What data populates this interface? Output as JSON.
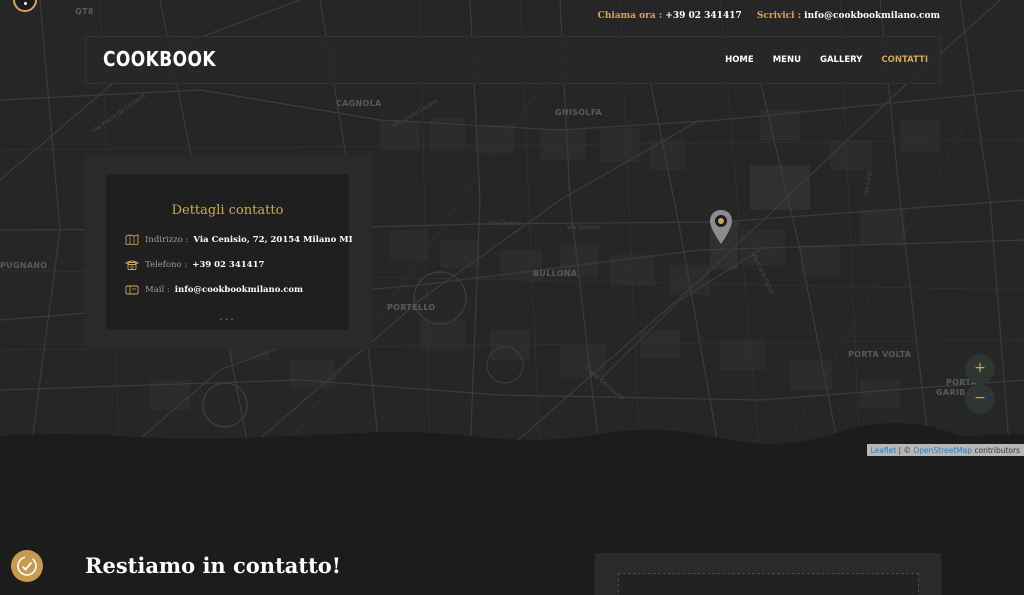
{
  "topbar": {
    "call_label": "Chiama ora :",
    "call_value": "+39 02 341417",
    "write_label": "Scrivici :",
    "write_value": "info@cookbookmilano.com"
  },
  "header": {
    "logo": "COOKBOOK",
    "nav": [
      {
        "label": "HOME",
        "active": false
      },
      {
        "label": "MENU",
        "active": false
      },
      {
        "label": "GALLERY",
        "active": false
      },
      {
        "label": "CONTATTI",
        "active": true
      }
    ]
  },
  "map": {
    "labels": {
      "cagnola": "CAGNOLA",
      "ghisolfa": "GHISOLFA",
      "bullona": "BULLONA",
      "portello": "PORTELLO",
      "porta_volta": "PORTA VOLTA",
      "porta": "PORTA",
      "garib": "GARIB",
      "qt8": "QT8",
      "pugnano": "PUGNANO"
    },
    "streets": {
      "via_cenisio_1": "Via Cenisio",
      "via_cenisio_2": "Via Cenisio",
      "via_pietro_da_cortona": "Via Pietro da Cortona",
      "via_giulio_cesare": "Via Giulio Cesare",
      "via_carlo_farini": "Via Carlo Farini",
      "via_luigi": "Via Luigi",
      "corso_sempione": "Corso Sempione"
    },
    "zoom_in": "+",
    "zoom_out": "−",
    "attribution": {
      "leaflet": "Leaflet",
      "sep": " | © ",
      "osm": "OpenStreetMap",
      "contrib": " contributors"
    },
    "marker_icon": "map-pin-icon"
  },
  "contact": {
    "title": "Dettagli contatto",
    "address_label": "Indirizzo :",
    "address_value": "Via Cenisio, 72, 20154 Milano MI",
    "phone_label": "Telefono :",
    "phone_value": "+39 02 341417",
    "mail_label": "Mail :",
    "mail_value": "info@cookbookmilano.com",
    "more": "..."
  },
  "section": {
    "title": "Restiamo in contatto!"
  },
  "colors": {
    "accent": "#d2a758",
    "background": "#1c1c1c",
    "map": "#262626"
  }
}
